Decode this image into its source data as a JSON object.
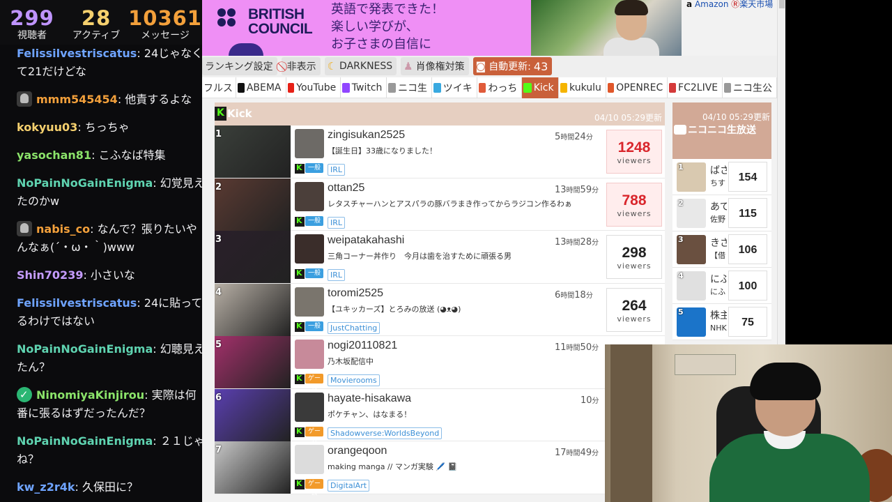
{
  "stats": [
    {
      "value": "299",
      "label": "視聴者",
      "color": "#bf94ff"
    },
    {
      "value": "28",
      "label": "アクティブ",
      "color": "#f5d06e"
    },
    {
      "value": "10361",
      "label": "メッセージ",
      "color": "#f3a03b"
    }
  ],
  "chat": [
    {
      "user": "Felissilvestriscatus",
      "color": "#6fa4ff",
      "badge": "",
      "text": ": 24じゃなくて21だけどな"
    },
    {
      "user": "mmm545454",
      "color": "#f3a03b",
      "badge": "owl",
      "text": ": 他責するよな"
    },
    {
      "user": "kokyuu03",
      "color": "#f5d06e",
      "badge": "",
      "text": ": ちっちゃ"
    },
    {
      "user": "yasochan81",
      "color": "#8be36a",
      "badge": "",
      "text": ": こふなば特集"
    },
    {
      "user": "NoPainNoGainEnigma",
      "color": "#5fd3b0",
      "badge": "",
      "text": ": 幻覚見えたのかw"
    },
    {
      "user": "nabis_co",
      "color": "#f3a03b",
      "badge": "owl",
      "text": ": なんで？張りたいやんなぁ(´・ω・｀)www"
    },
    {
      "user": "Shin70239",
      "color": "#c59cff",
      "badge": "",
      "text": ": 小さいな"
    },
    {
      "user": "Felissilvestriscatus",
      "color": "#6fa4ff",
      "badge": "",
      "text": ": 24に貼ってるわけではない"
    },
    {
      "user": "NoPainNoGainEnigma",
      "color": "#5fd3b0",
      "badge": "",
      "text": ": 幻聴見えたん？"
    },
    {
      "user": "NinomiyaKinjirou",
      "color": "#8be36a",
      "badge": "verified",
      "text": ": 実際は何番に張るはずだったんだ？"
    },
    {
      "user": "NoPainNoGainEnigma",
      "color": "#5fd3b0",
      "badge": "",
      "text": ": ２１じゃね？"
    },
    {
      "user": "kw_z2r4k",
      "color": "#6fa4ff",
      "badge": "",
      "text": ": 久保田に？"
    }
  ],
  "ad": {
    "brand_line1": "BRITISH",
    "brand_line2": "COUNCIL",
    "text_lines": [
      "英語で発表できた！",
      "楽しい学びが、",
      "お子さまの自信に"
    ]
  },
  "side_links": {
    "amazon": "Amazon",
    "rakuten": "楽天市場"
  },
  "toolbar": {
    "ranking_settings": "ランキング設定",
    "hide": "非表示",
    "darkness": "DARKNESS",
    "portrait": "肖像権対策",
    "auto_update": "自動更新:",
    "auto_update_count": "43"
  },
  "sites": [
    {
      "label": "フルス",
      "color": "",
      "active": false
    },
    {
      "label": "ABEMA",
      "color": "#111111",
      "active": false
    },
    {
      "label": "YouTube",
      "color": "#e62117",
      "active": false
    },
    {
      "label": "Twitch",
      "color": "#9146ff",
      "active": false
    },
    {
      "label": "ニコ生",
      "color": "#999999",
      "active": false
    },
    {
      "label": "ツイキ",
      "color": "#39a9e0",
      "active": false
    },
    {
      "label": "わっち",
      "color": "#e05b3a",
      "active": false
    },
    {
      "label": "Kick",
      "color": "#53fc18",
      "active": true
    },
    {
      "label": "kukulu",
      "color": "#f5b400",
      "active": false
    },
    {
      "label": "OPENREC",
      "color": "#e0572a",
      "active": false
    },
    {
      "label": "FC2LIVE",
      "color": "#d43a3a",
      "active": false
    },
    {
      "label": "ニコ生公",
      "color": "#999999",
      "active": false
    }
  ],
  "kick": {
    "title": "Kick",
    "updated": "04/10 05:29更新",
    "viewers_label": "viewers",
    "streams": [
      {
        "rank": "1",
        "user": "zingisukan2525",
        "h": "5",
        "m": "24",
        "title": "【誕生日】33歳になりました！",
        "cat": "一般",
        "cat_type": "general",
        "tag": "IRL",
        "viewers": "1248",
        "hot": true,
        "thumb": "#3a3f3a",
        "avatar": "#6d6a66"
      },
      {
        "rank": "2",
        "user": "ottan25",
        "h": "13",
        "m": "59",
        "title": "レタスチャーハンとアスパラの豚バラまき作ってからラジコン作るわぁ",
        "cat": "一般",
        "cat_type": "general",
        "tag": "IRL",
        "viewers": "788",
        "hot": true,
        "thumb": "#5a3a32",
        "avatar": "#4b3f3a"
      },
      {
        "rank": "3",
        "user": "weipatakahashi",
        "h": "13",
        "m": "28",
        "title": "三角コーナー丼作り　今月は歯を治すために頑張る男",
        "cat": "一般",
        "cat_type": "general",
        "tag": "IRL",
        "viewers": "298",
        "hot": false,
        "thumb": "#2a1f2a",
        "avatar": "#3a2d2a"
      },
      {
        "rank": "4",
        "user": "toromi2525",
        "h": "6",
        "m": "18",
        "title": "【ユキッカーズ】とろみの放送 (◕ᴥ◕)",
        "cat": "一般",
        "cat_type": "general",
        "tag": "JustChatting",
        "viewers": "264",
        "hot": false,
        "thumb": "#b8b0a6",
        "avatar": "#7a756d"
      },
      {
        "rank": "5",
        "user": "nogi20110821",
        "h": "11",
        "m": "50",
        "title": "乃木坂配信中",
        "cat": "ゲーム",
        "cat_type": "game",
        "tag": "Movierooms",
        "viewers": "",
        "hot": false,
        "thumb": "#a2306a",
        "avatar": "#c78a9a"
      },
      {
        "rank": "6",
        "user": "hayate-hisakawa",
        "h": "",
        "m": "10",
        "title": "ポケチャン、はなまる！",
        "cat": "ゲーム",
        "cat_type": "game",
        "tag": "Shadowverse:WorldsBeyond",
        "viewers": "",
        "hot": false,
        "thumb": "#5a3fb0",
        "avatar": "#3a3a3a"
      },
      {
        "rank": "7",
        "user": "orangeqoon",
        "h": "17",
        "m": "49",
        "title": "making manga // マンガ実験 🖊️ 📓",
        "cat": "ゲーム",
        "cat_type": "game",
        "tag": "DigitalArt",
        "viewers": "",
        "hot": false,
        "thumb": "#c8c8c8",
        "avatar": "#dcdcdc"
      }
    ]
  },
  "nico": {
    "updated": "04/10 05:29更新",
    "title": "ニコニコ生放送",
    "items": [
      {
        "rank": "1",
        "name": "ばさ",
        "sub": "ちす",
        "count": "154",
        "thumb": "#d9c9b0"
      },
      {
        "rank": "2",
        "name": "あて",
        "sub": "佐野",
        "count": "115",
        "thumb": "#e8e8e8"
      },
      {
        "rank": "3",
        "name": "きさ",
        "sub": "【借",
        "count": "106",
        "thumb": "#6a5040"
      },
      {
        "rank": "4",
        "name": "にふ",
        "sub": "にふ",
        "count": "100",
        "thumb": "#e0e0e0"
      },
      {
        "rank": "5",
        "name": "株主",
        "sub": "NHK",
        "count": "75",
        "thumb": "#1b74c9"
      }
    ]
  },
  "time_units": {
    "hour": "時間",
    "min": "分"
  }
}
